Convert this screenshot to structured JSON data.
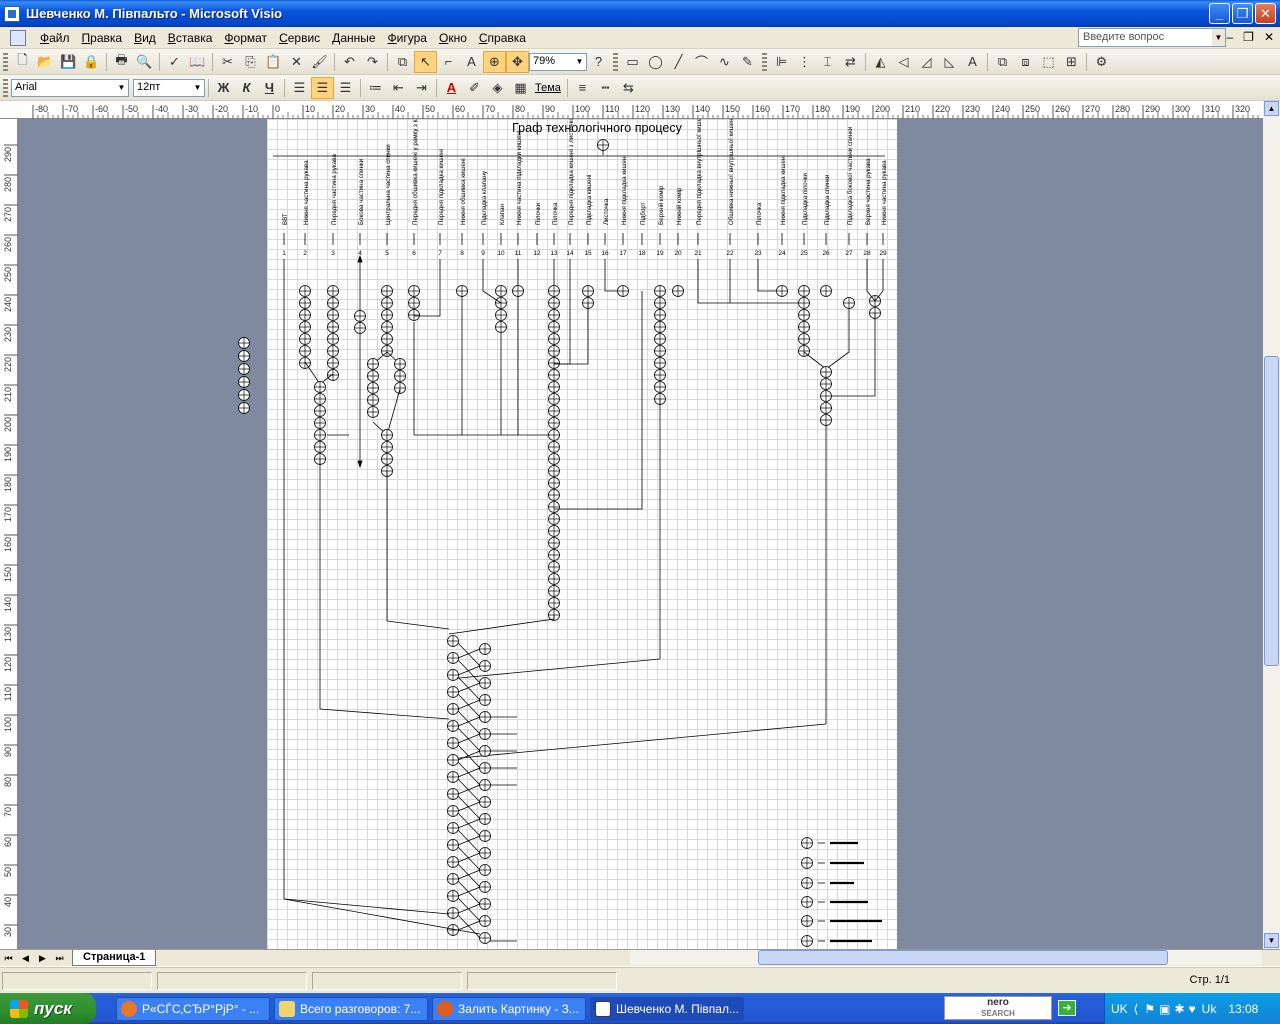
{
  "window": {
    "title": "Шевченко М. Півпальто - Microsoft Visio",
    "minimize": "_",
    "maximize": "❐",
    "close": "✕"
  },
  "menu": {
    "items": [
      "Файл",
      "Правка",
      "Вид",
      "Вставка",
      "Формат",
      "Сервис",
      "Данные",
      "Фигура",
      "Окно",
      "Справка"
    ],
    "help_placeholder": "Введите вопрос"
  },
  "toolbar": {
    "zoom": "79%",
    "font": "Arial",
    "size": "12пт",
    "bold": "Ж",
    "italic": "К",
    "underline": "Ч",
    "theme": "Тема"
  },
  "ruler": {
    "top_labels": [
      "-80",
      "-70",
      "-60",
      "-50",
      "-40",
      "-30",
      "-20",
      "-10",
      "0",
      "10",
      "20",
      "30",
      "40",
      "50",
      "60",
      "70",
      "80",
      "90",
      "100",
      "110",
      "120",
      "130",
      "140",
      "150",
      "160",
      "170",
      "180",
      "190",
      "200",
      "210",
      "220",
      "230",
      "240",
      "250",
      "260",
      "270",
      "280",
      "290",
      "300",
      "310",
      "320"
    ],
    "left_labels": [
      "290",
      "280",
      "270",
      "260",
      "250",
      "240",
      "230",
      "220",
      "210",
      "200",
      "190",
      "180",
      "170",
      "160",
      "150",
      "140",
      "130",
      "120",
      "110",
      "100",
      "90",
      "80",
      "70",
      "60",
      "50",
      "40",
      "30"
    ]
  },
  "diagram": {
    "title": "Граф технологічного процесу",
    "columns": [
      {
        "num": "1",
        "label": "ВВТ"
      },
      {
        "num": "2",
        "label": "Нижня частина рукава"
      },
      {
        "num": "3",
        "label": "Передня частина рукава"
      },
      {
        "num": "4",
        "label": "Бокова частина спинки"
      },
      {
        "num": "5",
        "label": "Центральна частина спинки"
      },
      {
        "num": "6",
        "label": "Передня обшивка кишені у рамку з клапаном"
      },
      {
        "num": "7",
        "label": "Передня підкладка кишені"
      },
      {
        "num": "8",
        "label": "Нижня обшивка кишені"
      },
      {
        "num": "9",
        "label": "Підкладка клапану"
      },
      {
        "num": "10",
        "label": "Клапан"
      },
      {
        "num": "11",
        "label": "Нижня частина підкладки кишені"
      },
      {
        "num": "12",
        "label": "Пілочки"
      },
      {
        "num": "13",
        "label": "Пілочка"
      },
      {
        "num": "14",
        "label": "Передня підкладка кишені з листочкою"
      },
      {
        "num": "15",
        "label": "Підкладка кишені"
      },
      {
        "num": "16",
        "label": "Листочка"
      },
      {
        "num": "17",
        "label": "Нижня підкладка кишені"
      },
      {
        "num": "18",
        "label": "Підборт"
      },
      {
        "num": "19",
        "label": "Верхній комір"
      },
      {
        "num": "20",
        "label": "Нижній комір"
      },
      {
        "num": "21",
        "label": "Передня підкладка внутрішньої кишені"
      },
      {
        "num": "22",
        "label": "Обшивка нижньої внутрішньої кишені рамки внутрішньої кишені"
      },
      {
        "num": "23",
        "label": "Пілочка"
      },
      {
        "num": "24",
        "label": "Нижня підкладка кишені"
      },
      {
        "num": "25",
        "label": "Підкладка пілочки"
      },
      {
        "num": "26",
        "label": "Підкладка спинки"
      },
      {
        "num": "27",
        "label": "Підкладка бокової частини спинки"
      },
      {
        "num": "28",
        "label": "Верхня частина рукава"
      },
      {
        "num": "29",
        "label": "Нижня частина рукава"
      }
    ]
  },
  "tabs": {
    "page_tab": "Страница-1",
    "first": "⏮",
    "prev": "◀",
    "next": "▶",
    "last": "⏭"
  },
  "status": {
    "page_info": "Стр. 1/1"
  },
  "taskbar": {
    "start": "пуск",
    "tasks": [
      {
        "label": "Р«СЃС‚СЂР°РјР° - ..."
      },
      {
        "label": "Всего разговоров: 7..."
      },
      {
        "label": "Залить Картинку - З..."
      },
      {
        "label": "Шевченко М. Півпал..."
      }
    ],
    "nero_top": "nero",
    "nero_bottom": "SEARCH",
    "lang1": "UK",
    "lang2": "Uk",
    "time": "13:08"
  },
  "colors": {
    "titlebar": "#0447c8",
    "workspace": "#7f8aa0",
    "taskbar": "#245edb",
    "start": "#2f8f2f"
  }
}
